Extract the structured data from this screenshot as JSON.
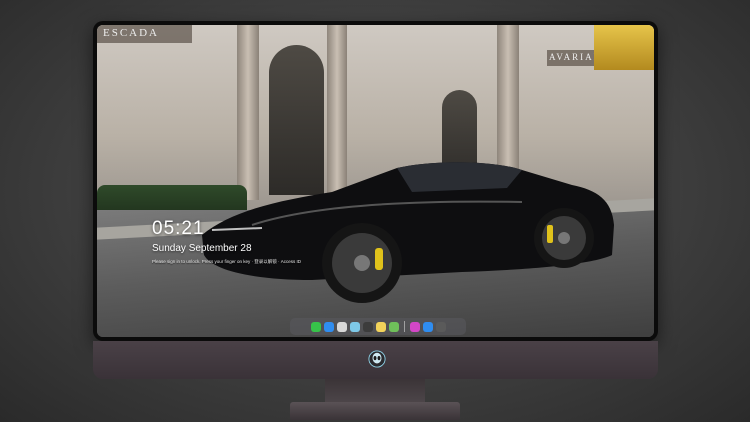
{
  "lock_screen": {
    "time": "05:21",
    "date": "Sunday September  28",
    "message": "Please sign in to unlock. Press your finger on key · 登录以解锁 · Access ID"
  },
  "signs": {
    "left": "ESCADA",
    "right": "AVARIAN"
  },
  "dock": {
    "icons": [
      {
        "name": "messages-icon",
        "color": "#37c24a"
      },
      {
        "name": "finder-icon",
        "color": "#2f8df0"
      },
      {
        "name": "clock-icon",
        "color": "#d8d8d8"
      },
      {
        "name": "photos-icon",
        "color": "#7ec9e8"
      },
      {
        "name": "clapper-icon",
        "color": "#3c3c3c"
      },
      {
        "name": "notes-icon",
        "color": "#f2d35a"
      },
      {
        "name": "preview-icon",
        "color": "#6fbf5a"
      },
      {
        "name": "music-icon",
        "color": "#d347c7"
      },
      {
        "name": "app-store-icon",
        "color": "#2f8df0"
      },
      {
        "name": "camera-icon",
        "color": "#5a5a5a"
      }
    ]
  }
}
